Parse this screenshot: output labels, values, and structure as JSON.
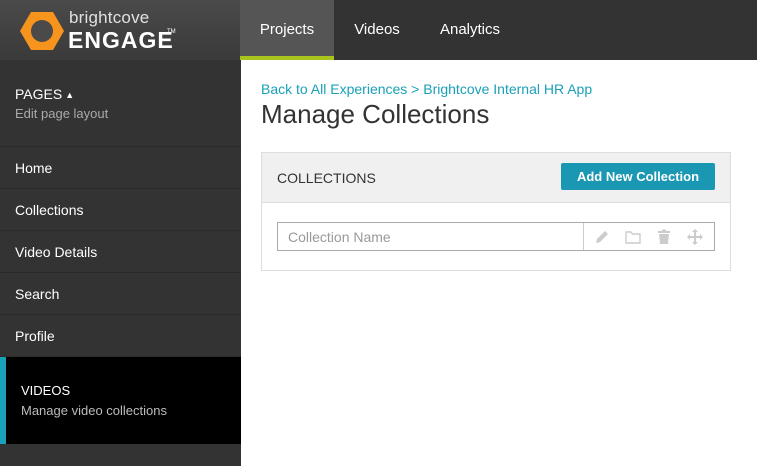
{
  "brand": {
    "top": "brightcove",
    "bottom": "ENGAGE",
    "tm": "TM",
    "accent": "#f7941d"
  },
  "nav": {
    "tabs": [
      {
        "label": "Projects",
        "active": true
      },
      {
        "label": "Videos",
        "active": false
      },
      {
        "label": "Analytics",
        "active": false
      }
    ]
  },
  "sidebar": {
    "pages": {
      "title": "PAGES",
      "arrow": "▲",
      "subtitle": "Edit page layout"
    },
    "items": [
      {
        "label": "Home"
      },
      {
        "label": "Collections"
      },
      {
        "label": "Video Details"
      },
      {
        "label": "Search"
      },
      {
        "label": "Profile"
      }
    ],
    "videos": {
      "title": "VIDEOS",
      "subtitle": "Manage video collections"
    }
  },
  "main": {
    "breadcrumb": "Back to All Experiences > Brightcove Internal HR App",
    "title": "Manage Collections",
    "panel": {
      "title": "COLLECTIONS",
      "add_button": "Add New Collection",
      "input_placeholder": "Collection Name",
      "row_icons": [
        "pencil-icon",
        "folder-icon",
        "trash-icon",
        "move-icon"
      ]
    }
  },
  "colors": {
    "accent_teal": "#1aa0b8",
    "active_tab_bar": "#a9c41c"
  }
}
